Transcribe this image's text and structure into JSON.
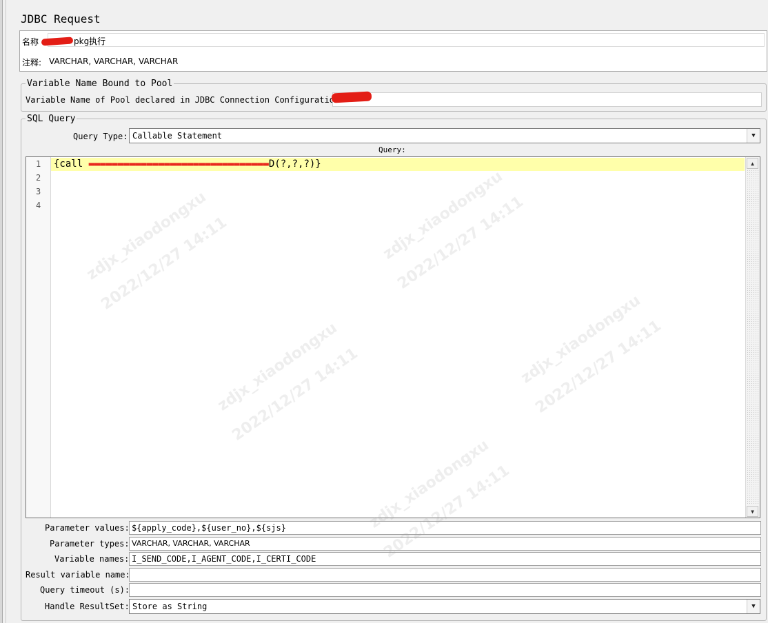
{
  "panel": {
    "title": "JDBC Request"
  },
  "name_field": {
    "label": "名称",
    "value": "pkg执行"
  },
  "comment_field": {
    "label": "注释:",
    "value": "VARCHAR, VARCHAR, VARCHAR"
  },
  "pool_group": {
    "legend": "Variable Name Bound to Pool",
    "label": "Variable Name of Pool declared in JDBC Connection Configuration:",
    "value": ""
  },
  "sql_group": {
    "legend": "SQL Query",
    "query_type_label": "Query Type:",
    "query_type_value": "Callable Statement",
    "query_label": "Query:",
    "line_numbers": [
      "1",
      "2",
      "3",
      "4"
    ],
    "code_line_1_start": "{call ",
    "code_line_1_end": "D(?,?,?)}"
  },
  "params": {
    "values_label": "Parameter values:",
    "values": "${apply_code},${user_no},${sjs}",
    "types_label": "Parameter types:",
    "types": "VARCHAR, VARCHAR, VARCHAR",
    "names_label": "Variable names:",
    "names": "I_SEND_CODE,I_AGENT_CODE,I_CERTI_CODE",
    "result_label": "Result variable name:",
    "result": "",
    "timeout_label": "Query timeout (s):",
    "timeout": "",
    "handle_label": "Handle ResultSet:",
    "handle": "Store as String"
  },
  "watermark": {
    "line1": "zdjx_xiaodongxu",
    "line2": "2022/12/27 14:11"
  },
  "colors": {
    "current_line": "#ffffaa",
    "redaction": "#e31d15",
    "background": "#f0f0f0"
  }
}
